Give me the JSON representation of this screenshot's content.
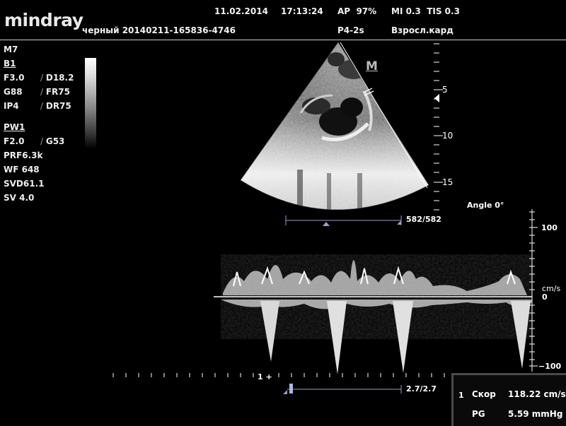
{
  "header": {
    "brand": "mindray",
    "date": "11.02.2014",
    "time": "17:13:24",
    "ap": "AP  97%",
    "mi_tis": "MI 0.3  TIS 0.3",
    "patient": "черный 20140211-165836-4746",
    "probe": "P4-2s",
    "preset": "Взросл.кард"
  },
  "params": {
    "mode": "M7",
    "b1_title": "B1",
    "b1_rows": [
      [
        "F3.0",
        "D18.2"
      ],
      [
        "G88",
        "FR75"
      ],
      [
        "IP4",
        "DR75"
      ]
    ],
    "pw1_title": "PW1",
    "pw1_row": [
      "F2.0",
      "G53"
    ],
    "pw1_lines": [
      "PRF6.3k",
      "WF 648",
      "SVD61.1",
      "SV 4.0"
    ]
  },
  "image": {
    "marker": "M",
    "depth_labels": [
      "5",
      "10",
      "15"
    ],
    "line_counter": "582/582",
    "angle": "Angle 0°"
  },
  "doppler": {
    "scale_top": "100",
    "unit": "cm/s",
    "zero": "0",
    "scale_bottom": "−100",
    "sweep_label": "2.7/2.7",
    "cursor_label": "1 +"
  },
  "measure": {
    "index": "1",
    "vel_label": "Скор",
    "vel_value": "118.22 cm/s",
    "pg_label": "PG",
    "pg_value": "5.59 mmHg"
  }
}
